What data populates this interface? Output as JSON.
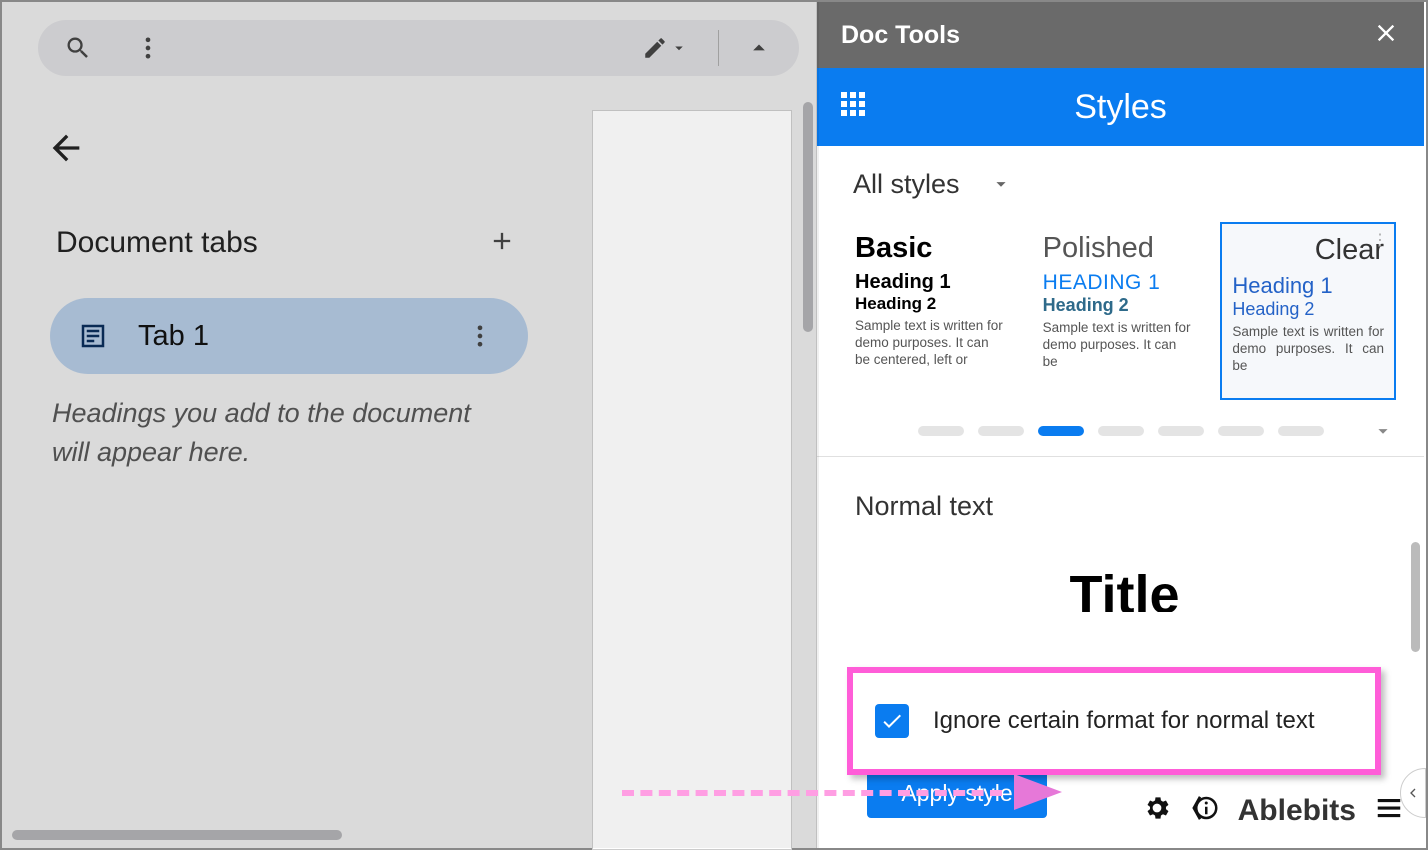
{
  "docTabs": {
    "header": "Document tabs",
    "tab1": "Tab 1",
    "hint": "Headings you add to the document will appear here."
  },
  "panel": {
    "title": "Doc Tools",
    "section": "Styles",
    "filter": "All styles",
    "cards": {
      "basic": {
        "title": "Basic",
        "h1": "Heading 1",
        "h2": "Heading 2",
        "body": "Sample text is written for demo purposes. It can be centered, left or"
      },
      "polished": {
        "title": "Polished",
        "h1": "HEADING 1",
        "h2": "Heading 2",
        "body": "Sample text is written for demo purposes. It can be"
      },
      "clear": {
        "title": "Clear",
        "h1": "Heading 1",
        "h2": "Heading 2",
        "body": "Sample text is written for demo purposes. It can be"
      }
    },
    "normalText": "Normal text",
    "titlePreview": "Title",
    "checkboxLabel": "Ignore certain format for normal text",
    "applyBtn": "Apply style",
    "brand": "Ablebits"
  }
}
